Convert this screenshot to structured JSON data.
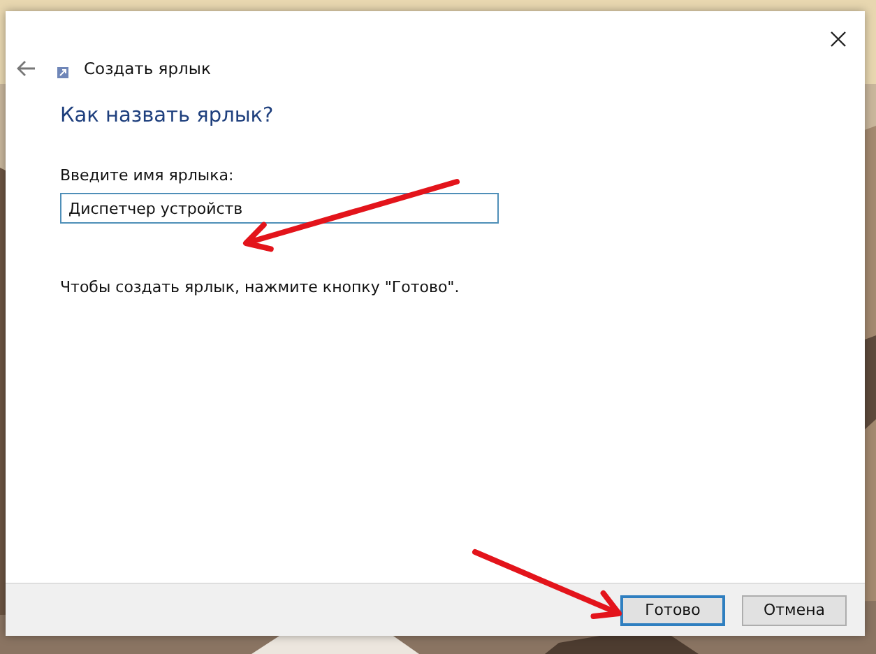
{
  "window": {
    "title": "Создать ярлык"
  },
  "heading": "Как назвать ярлык?",
  "name_field": {
    "label": "Введите имя ярлыка:",
    "value": "Диспетчер устройств"
  },
  "hint": "Чтобы создать ярлык, нажмите кнопку \"Готово\".",
  "buttons": [
    {
      "label": "Готово",
      "default": true
    },
    {
      "label": "Отмена",
      "default": false
    }
  ],
  "annotations": [
    {
      "kind": "arrow"
    },
    {
      "kind": "arrow"
    }
  ]
}
